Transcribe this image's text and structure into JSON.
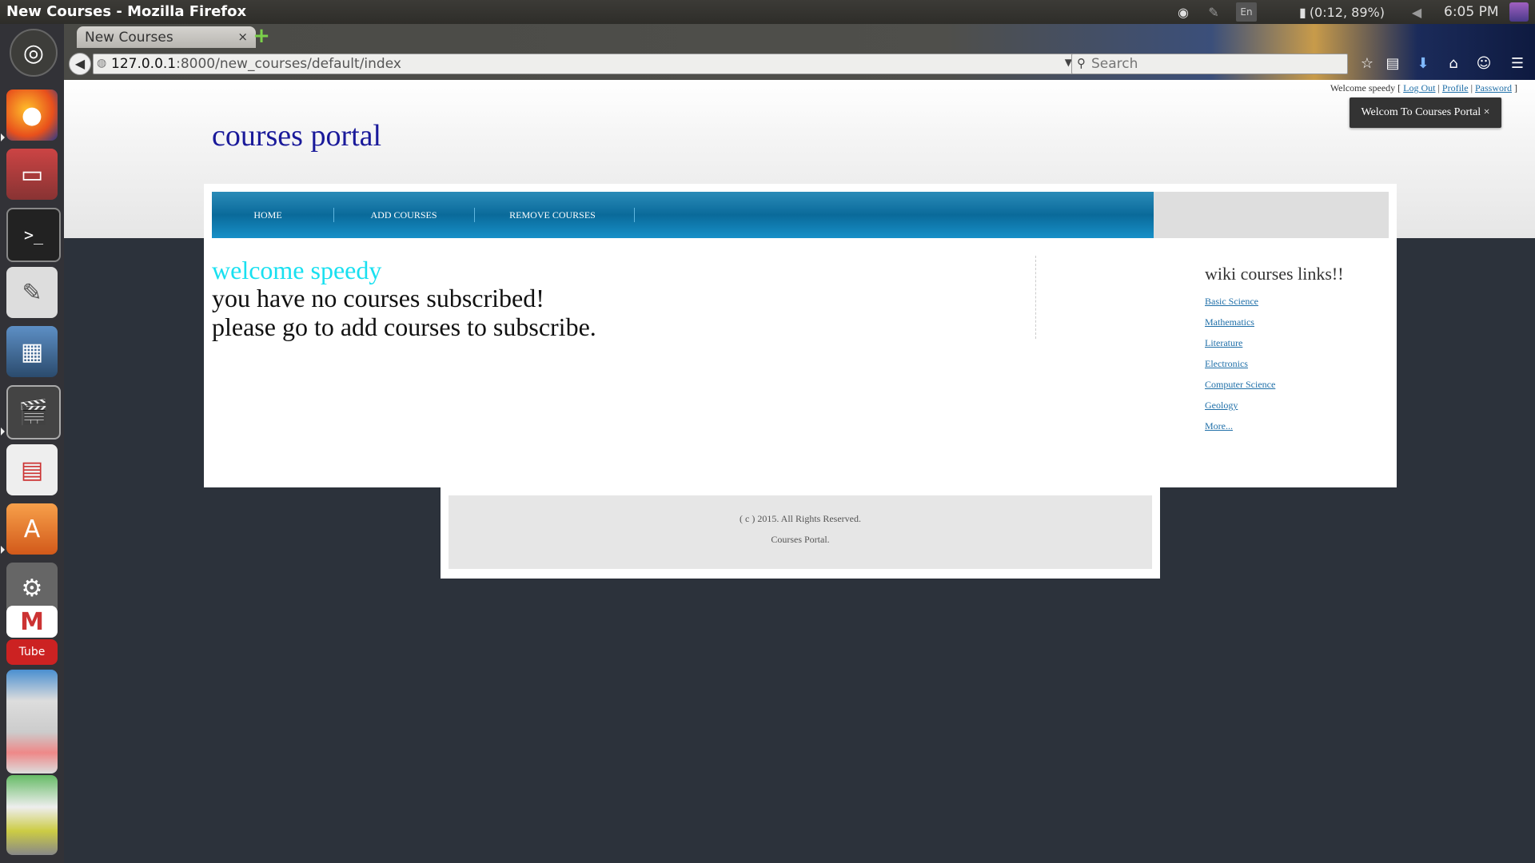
{
  "window": {
    "title": "New Courses - Mozilla Firefox"
  },
  "system_tray": {
    "lang": "En",
    "battery": "(0:12, 89%)",
    "clock": "6:05 PM"
  },
  "launcher": {
    "items": [
      "ubuntu-dash",
      "firefox",
      "files",
      "terminal",
      "text-editor",
      "image-viewer",
      "video-editor",
      "impress",
      "software-center",
      "system-settings",
      "gmail",
      "youtube",
      "app-a",
      "app-b",
      "app-c",
      "app-d",
      "app-e",
      "app-f",
      "app-g"
    ]
  },
  "browser": {
    "tab_title": "New Courses",
    "url_host": "127.0.0.1",
    "url_rest": ":8000/new_courses/default/index",
    "search_placeholder": "Search"
  },
  "page": {
    "auth": {
      "prefix": "Welcome speedy [ ",
      "logout": "Log Out",
      "sep1": " | ",
      "profile": "Profile",
      "sep2": " | ",
      "password": "Password",
      "suffix": " ]"
    },
    "flash": "Welcom To Courses Portal ×",
    "site_title": "courses portal",
    "nav": [
      "HOME",
      "ADD COURSES",
      "REMOVE COURSES"
    ],
    "welcome": "welcome speedy",
    "message_line1": "you have no courses subscribed!",
    "message_line2": "please go to add courses to subscribe.",
    "wiki": {
      "title": "wiki courses links!!",
      "links": [
        "Basic Science",
        "Mathematics",
        "Literature",
        "Electronics",
        "Computer Science",
        "Geology",
        "More..."
      ]
    },
    "footer": {
      "line1": "( c ) 2015. All Rights Reserved.",
      "line2": "Courses Portal."
    }
  },
  "colors": {
    "nav_blue": "#0a6a9a",
    "welcome_cyan": "#19e0f0",
    "title_blue": "#1a1a9a",
    "link_blue": "#1f6fa8"
  }
}
